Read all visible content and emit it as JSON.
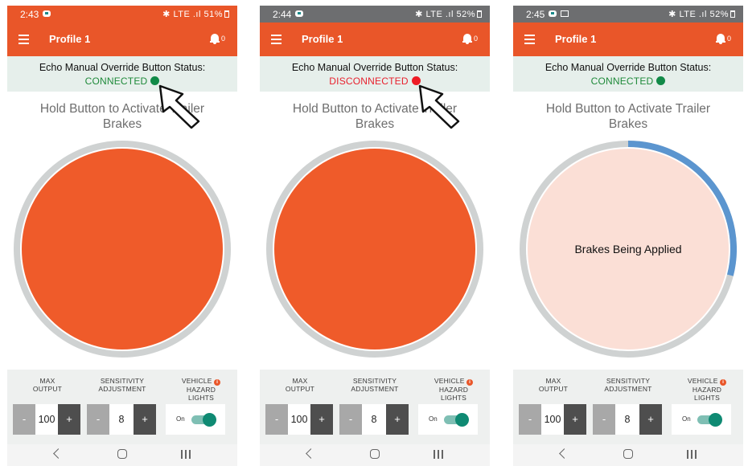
{
  "colors": {
    "brand_orange": "#e95629",
    "connected_green": "#1f8a3a",
    "disconnected_red": "#e8212e",
    "progress_blue": "#5b95cf"
  },
  "screens": [
    {
      "status_bar": {
        "time": "2:43",
        "indicators": "✱ LTE .ıl 51%"
      },
      "app_bar": {
        "title": "Profile 1",
        "notification_count": "0"
      },
      "button_status": {
        "title": "Echo Manual Override Button Status:",
        "state": "CONNECTED",
        "dot_color": "#128a48"
      },
      "instruction": "Hold Button to Activate Trailer Brakes",
      "brake_button": {
        "label": "",
        "progress": 0
      },
      "controls": {
        "max_output": {
          "label_1": "MAX",
          "label_2": "OUTPUT",
          "minus": "-",
          "value": "100",
          "plus": "+"
        },
        "sensitivity": {
          "label_1": "SENSITIVITY",
          "label_2": "ADJUSTMENT",
          "minus": "-",
          "value": "8",
          "plus": "+"
        },
        "hazard": {
          "label_1": "VEHICLE",
          "label_2": "HAZARD LIGHTS",
          "toggle_label": "On",
          "toggle_on": true
        }
      },
      "pointer_icon": "arrow-cursor-icon"
    },
    {
      "status_bar": {
        "time": "2:44",
        "indicators": "✱ LTE .ıl 52%"
      },
      "app_bar": {
        "title": "Profile 1",
        "notification_count": "0"
      },
      "button_status": {
        "title": "Echo Manual Override Button Status:",
        "state": "DISCONNECTED",
        "dot_color": "#ee1c25"
      },
      "instruction": "Hold Button to Activate Trailer Brakes",
      "brake_button": {
        "label": "",
        "progress": 0
      },
      "controls": {
        "max_output": {
          "label_1": "MAX",
          "label_2": "OUTPUT",
          "minus": "-",
          "value": "100",
          "plus": "+"
        },
        "sensitivity": {
          "label_1": "SENSITIVITY",
          "label_2": "ADJUSTMENT",
          "minus": "-",
          "value": "8",
          "plus": "+"
        },
        "hazard": {
          "label_1": "VEHICLE",
          "label_2": "HAZARD LIGHTS",
          "toggle_label": "On",
          "toggle_on": true
        }
      },
      "pointer_icon": "arrow-cursor-icon"
    },
    {
      "status_bar": {
        "time": "2:45",
        "indicators": "✱ LTE .ıl 52%"
      },
      "app_bar": {
        "title": "Profile 1",
        "notification_count": "0"
      },
      "button_status": {
        "title": "Echo Manual Override Button Status:",
        "state": "CONNECTED",
        "dot_color": "#128a48"
      },
      "instruction": "Hold Button to Activate Trailer Brakes",
      "brake_button": {
        "label": "Brakes Being Applied",
        "progress": 0.29
      },
      "controls": {
        "max_output": {
          "label_1": "MAX",
          "label_2": "OUTPUT",
          "minus": "-",
          "value": "100",
          "plus": "+"
        },
        "sensitivity": {
          "label_1": "SENSITIVITY",
          "label_2": "ADJUSTMENT",
          "minus": "-",
          "value": "8",
          "plus": "+"
        },
        "hazard": {
          "label_1": "VEHICLE",
          "label_2": "HAZARD LIGHTS",
          "toggle_label": "On",
          "toggle_on": true
        }
      }
    }
  ]
}
